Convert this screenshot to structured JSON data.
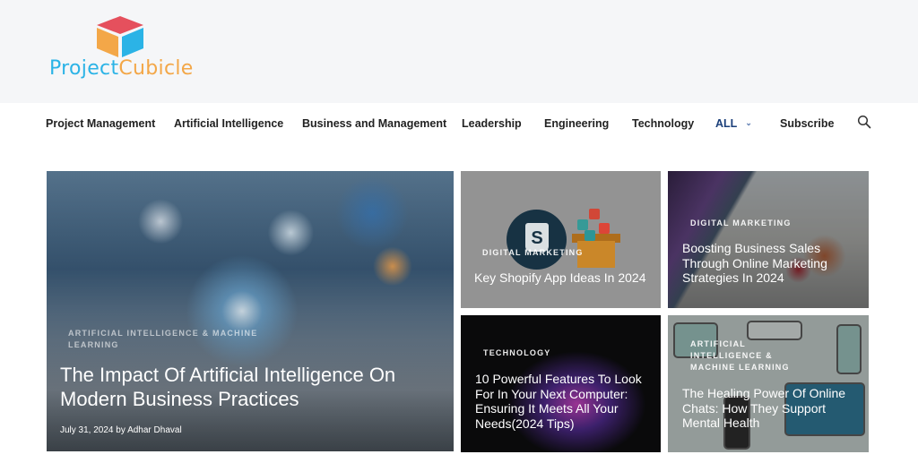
{
  "brand": {
    "name_part1": "Project",
    "name_part2": "Cubicle",
    "colors": {
      "cube_top": "#e5505d",
      "cube_left": "#f3a748",
      "cube_right": "#2bb3e6",
      "text_blue": "#2bb3e6",
      "text_orange": "#f3a748"
    }
  },
  "nav": {
    "items": [
      {
        "label": "Project Management"
      },
      {
        "label": "Artificial Intelligence"
      },
      {
        "label": "Business and Management"
      },
      {
        "label": "Leadership"
      },
      {
        "label": "Engineering"
      },
      {
        "label": "Technology"
      },
      {
        "label": "ALL",
        "has_dropdown": true
      },
      {
        "label": "Subscribe"
      }
    ],
    "search_icon": "search-icon",
    "dropdown_icon": "chevron-down-icon",
    "dropdown_glyph": "⌄",
    "active_color": "#1b3f7a"
  },
  "featured": {
    "category": "Artificial Intelligence & Machine Learning",
    "title": "The Impact Of Artificial Intelligence On Modern Business Practices",
    "date": "July 31, 2024",
    "by": "by",
    "author": "Adhar Dhaval"
  },
  "cards": [
    {
      "category": "Digital Marketing",
      "title": "Key Shopify App Ideas In 2024"
    },
    {
      "category": "Digital Marketing",
      "title": "Boosting Business Sales Through Online Marketing Strategies In 2024"
    },
    {
      "category": "Technology",
      "title": "10 Powerful Features To Look For In Your Next Computer: Ensuring It Meets All Your Needs(2024 Tips)"
    },
    {
      "category": "Artificial Intelligence & Machine Learning",
      "title": "The Healing Power Of Online Chats: How They Support Mental Health"
    }
  ],
  "shopify_logo_letter": "S"
}
